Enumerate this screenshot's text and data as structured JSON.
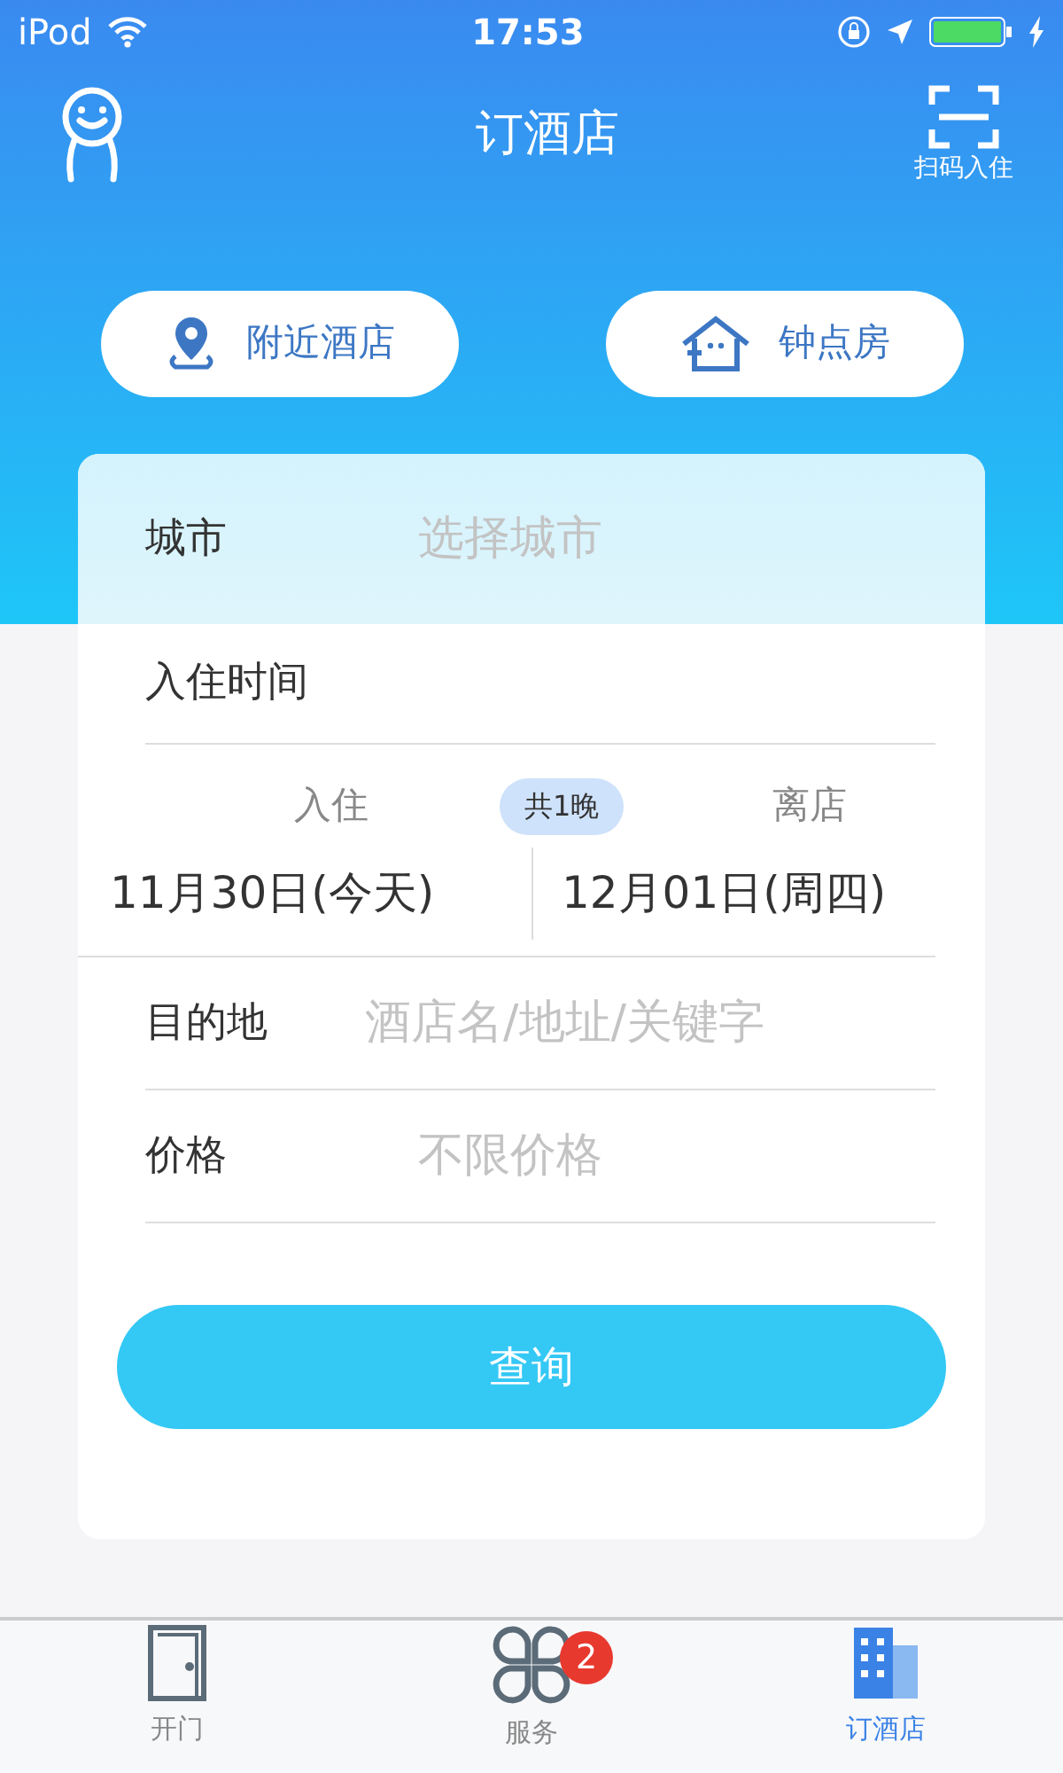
{
  "status_bar": {
    "carrier": "iPod",
    "time": "17:53"
  },
  "header": {
    "title": "订酒店",
    "scan_label": "扫码入住"
  },
  "quick_buttons": [
    {
      "label": "附近酒店",
      "kind": "location"
    },
    {
      "label": "钟点房",
      "kind": "house"
    }
  ],
  "form": {
    "city": {
      "label": "城市",
      "placeholder": "选择城市"
    },
    "stay_label": "入住时间",
    "checkin_label": "入住",
    "nights": "共1晚",
    "checkout_label": "离店",
    "checkin_date": "11月30日(今天)",
    "checkout_date": "12月01日(周四)",
    "destination": {
      "label": "目的地",
      "placeholder": "酒店名/地址/关键字"
    },
    "price": {
      "label": "价格",
      "placeholder": "不限价格"
    },
    "search_button": "查询"
  },
  "tabs": [
    {
      "label": "开门",
      "kind": "door",
      "selected": false
    },
    {
      "label": "服务",
      "kind": "services",
      "badge": "2",
      "selected": false
    },
    {
      "label": "订酒店",
      "kind": "hotel",
      "selected": true
    }
  ]
}
